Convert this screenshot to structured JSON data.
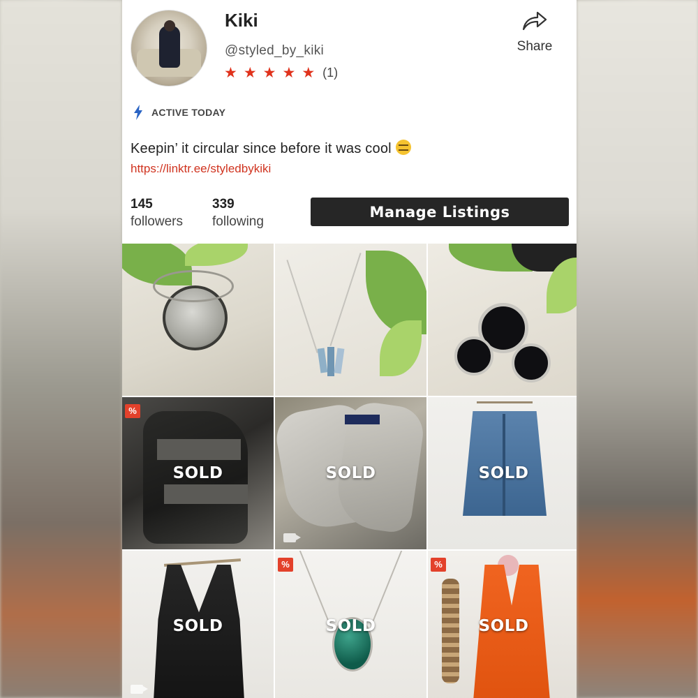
{
  "profile": {
    "name": "Kiki",
    "handle": "@styled_by_kiki",
    "rating_count": "(1)",
    "stars": 5,
    "share_label": "Share",
    "activity": "ACTIVE TODAY",
    "bio": "Keepin’ it circular since before it was cool",
    "link": "https://linktr.ee/styledbykiki"
  },
  "stats": {
    "followers_count": "145",
    "followers_label": "followers",
    "following_count": "339",
    "following_label": "following"
  },
  "actions": {
    "manage_label": "Manage Listings"
  },
  "listings": [
    {
      "item": "ring",
      "sold": false
    },
    {
      "item": "crystal necklace",
      "sold": false
    },
    {
      "item": "starburst earrings",
      "sold": false
    },
    {
      "item": "leather boots",
      "sold": true,
      "sold_label": "SOLD",
      "discount_badge": "%",
      "video": false
    },
    {
      "item": "sneakers",
      "sold": true,
      "sold_label": "SOLD",
      "video": true
    },
    {
      "item": "denim skirt",
      "sold": true,
      "sold_label": "SOLD"
    },
    {
      "item": "black romper",
      "sold": true,
      "sold_label": "SOLD",
      "video": true
    },
    {
      "item": "green pendant necklace",
      "sold": true,
      "sold_label": "SOLD",
      "discount_badge": "%"
    },
    {
      "item": "orange vest",
      "sold": true,
      "sold_label": "SOLD",
      "discount_badge": "%"
    }
  ],
  "colors": {
    "accent": "#e0321c",
    "link": "#d0331f",
    "button_bg": "#262626",
    "active_bolt": "#2a64c4"
  }
}
